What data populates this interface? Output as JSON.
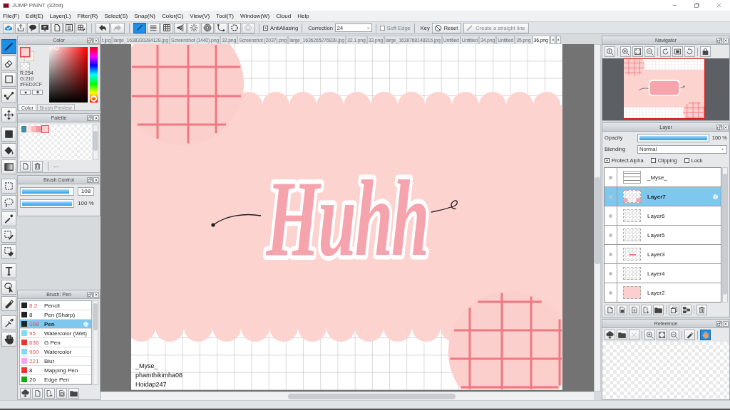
{
  "window": {
    "title": "JUMP PAINT (32bit)"
  },
  "menu": [
    "File(F)",
    "Edit(E)",
    "Layer(L)",
    "Filter(R)",
    "Select(S)",
    "Snap(N)",
    "Color(C)",
    "View(V)",
    "Tool(T)",
    "Window(W)",
    "Cloud",
    "Help"
  ],
  "toolbar": {
    "undo": {
      "disabled": false
    },
    "redo": {
      "disabled": true
    },
    "ruler_tools": [
      {
        "selected": true,
        "disabled": false
      },
      {
        "selected": false,
        "disabled": false
      },
      {
        "selected": false,
        "disabled": false
      },
      {
        "selected": false,
        "disabled": false
      },
      {
        "selected": false,
        "disabled": false
      },
      {
        "selected": false,
        "disabled": false
      },
      {
        "selected": false,
        "disabled": false
      },
      {
        "selected": false,
        "disabled": false
      },
      {
        "selected": false,
        "disabled": true
      }
    ],
    "anti_aliasing": {
      "label": "AntiAliasing",
      "checked": true
    },
    "correction": {
      "label": "Correction",
      "value": "24"
    },
    "soft_edge": {
      "label": "Soft Edge",
      "checked": false,
      "disabled": true
    },
    "key_label": "Key",
    "reset": {
      "label": "Reset"
    },
    "straight_line": {
      "label": "Create a straight line",
      "disabled": true
    }
  },
  "tools": [
    {
      "selected": true
    },
    {
      "selected": false
    },
    {
      "selected": false
    },
    {
      "selected": false
    },
    {
      "selected": false
    },
    {
      "selected": false
    },
    {
      "selected": false
    },
    {
      "selected": false
    },
    {
      "selected": false
    },
    {
      "selected": false
    },
    {
      "selected": false
    },
    {
      "selected": false
    },
    {
      "selected": false
    },
    {
      "selected": false
    },
    {
      "selected": false
    },
    {
      "selected": false
    },
    {
      "selected": false
    },
    {
      "selected": false
    }
  ],
  "color_panel": {
    "title": "Color",
    "readouts": [
      "R:254",
      "G:210",
      "#FED2CF"
    ],
    "tabs": [
      {
        "label": "Color",
        "selected": true
      },
      {
        "label": "Brush Preview",
        "selected": false
      }
    ]
  },
  "palette": {
    "title": "Palette",
    "swatches": [
      {
        "color": "#3f8ea3",
        "selected": false
      },
      {
        "color": "#fde0e0",
        "selected": false
      },
      {
        "color": "#f9b8bd",
        "selected": false
      },
      {
        "color": "#f3979f",
        "selected": false
      },
      {
        "color": "#fed2cf",
        "selected": true
      }
    ],
    "set_label": "---"
  },
  "brush_control": {
    "title": "Brush Control",
    "size": {
      "level": 0.94,
      "value": "108"
    },
    "opacity": {
      "level": 1,
      "reading": "100 %"
    }
  },
  "brush_list": {
    "title": "Brush: Pen",
    "brushes": [
      {
        "color": "#222222",
        "size": "8.2",
        "size_marked": true,
        "name": "Pencil",
        "selected": false
      },
      {
        "color": "#222222",
        "size": "8",
        "size_marked": false,
        "name": "Pen (Sharp)",
        "selected": false
      },
      {
        "color": "#222222",
        "size": "108",
        "size_marked": true,
        "name": "Pen",
        "selected": true
      },
      {
        "color": "#7fdcf4",
        "size": "95",
        "size_marked": true,
        "name": "Watercolor (Wet)",
        "selected": false
      },
      {
        "color": "#ec3434",
        "size": "636",
        "size_marked": true,
        "name": "G Pen",
        "selected": false
      },
      {
        "color": "#7fdcf4",
        "size": "900",
        "size_marked": true,
        "name": "Watercolor",
        "selected": false
      },
      {
        "color": "#f6a6f0",
        "size": "221",
        "size_marked": true,
        "name": "Blur",
        "selected": false
      },
      {
        "color": "#ec3434",
        "size": "8",
        "size_marked": false,
        "name": "Mapping Pen",
        "selected": false
      },
      {
        "color": "#1aa51a",
        "size": "20",
        "size_marked": false,
        "name": "Edge Pen",
        "selected": false
      }
    ]
  },
  "canvas": {
    "tabs": [
      {
        "label": "t.jpg",
        "selected": false
      },
      {
        "label": "large_1638330284128.jpg",
        "selected": false
      },
      {
        "label": "Screenshot (1440).png",
        "selected": false
      },
      {
        "label": "32.png",
        "selected": false
      },
      {
        "label": "Screenshot (2037).png",
        "selected": false
      },
      {
        "label": "large_1636265276839.jpg",
        "selected": false
      },
      {
        "label": "32.1.png",
        "selected": false
      },
      {
        "label": "33.png",
        "selected": false
      },
      {
        "label": "large_1638768148316.jpg",
        "selected": false
      },
      {
        "label": "Untitled",
        "selected": false
      },
      {
        "label": "Untitled",
        "selected": false
      },
      {
        "label": "34.png",
        "selected": false
      },
      {
        "label": "Untitled",
        "selected": false
      },
      {
        "label": "35.png",
        "selected": false
      },
      {
        "label": "36.png",
        "selected": true
      }
    ],
    "artwork": {
      "lettering": "Huhh",
      "signature": [
        "_Myse_",
        "phamthikimha08",
        "Hoidap247"
      ]
    }
  },
  "navigator": {
    "title": "Navigator"
  },
  "layer_panel": {
    "title": "Layer",
    "opacity": {
      "label": "Opacity",
      "level": 1,
      "reading": "100 %"
    },
    "blending": {
      "label": "Blending",
      "value": "Normal"
    },
    "options": [
      {
        "label": "Protect Alpha",
        "checked": true
      },
      {
        "label": "Clipping",
        "checked": false
      },
      {
        "label": "Lock",
        "checked": false
      }
    ],
    "layers": [
      {
        "name": "_Myse_",
        "kind": "text",
        "selected": false
      },
      {
        "name": "Layer7",
        "kind": "corners",
        "selected": true
      },
      {
        "name": "Layer6",
        "kind": "blank",
        "selected": false
      },
      {
        "name": "Layer5",
        "kind": "blank",
        "selected": false
      },
      {
        "name": "Layer3",
        "kind": "stroke",
        "selected": false
      },
      {
        "name": "Layer4",
        "kind": "blank",
        "selected": false
      },
      {
        "name": "Layer2",
        "kind": "fill",
        "selected": false
      }
    ]
  },
  "reference": {
    "title": "Reference",
    "tools": [
      {
        "selected": false,
        "disabled": false
      },
      {
        "selected": false,
        "disabled": false
      },
      {
        "selected": false,
        "disabled": true
      },
      {
        "selected": false,
        "disabled": false
      },
      {
        "selected": false,
        "disabled": false
      },
      {
        "selected": false,
        "disabled": false
      },
      {
        "selected": false,
        "disabled": false
      },
      {
        "selected": true,
        "disabled": false
      }
    ]
  }
}
